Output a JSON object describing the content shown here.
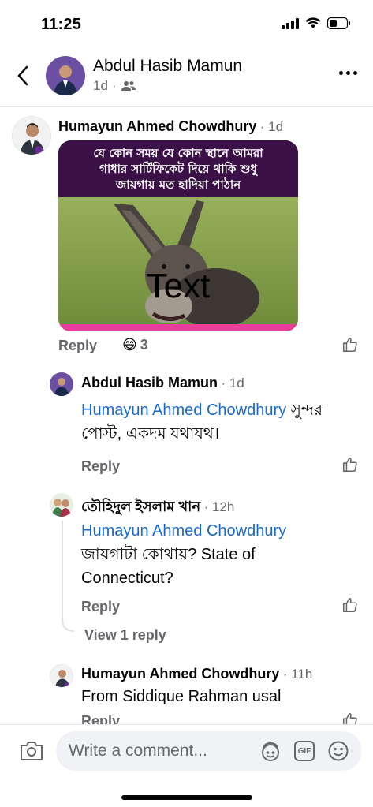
{
  "status": {
    "time": "11:25"
  },
  "header": {
    "name": "Abdul Hasib Mamun",
    "age": "1d",
    "dot": "·"
  },
  "comments": [
    {
      "author": "Humayun Ahmed Chowdhury",
      "time": "· 1d",
      "meme_banner_line1": "যে কোন সময় যে কোন স্থানে আমরা",
      "meme_banner_line2": "গাধার সার্টিফিকেট দিয়ে থাকি শুধু",
      "meme_banner_line3": "জায়গায় মত হাদিয়া পাঠান",
      "meme_overlay": "Text",
      "reply_label": "Reply",
      "reaction_emoji": "😄",
      "reaction_count": "3"
    },
    {
      "author": "Abdul Hasib Mamun",
      "time": "· 1d",
      "mention": "Humayun Ahmed Chowdhury",
      "text_inline": " সুন্দর",
      "text_line2": "পোস্ট, একদম যথাযথ।",
      "reply_label": "Reply"
    },
    {
      "author": "তৌহিদুল ইসলাম খান",
      "time": "· 12h",
      "mention": "Humayun Ahmed Chowdhury",
      "text_line1": "জায়গাটা কোথায়? State of",
      "text_line2": "Connecticut?",
      "reply_label": "Reply",
      "view_replies": "View 1 reply"
    },
    {
      "author": "Humayun Ahmed Chowdhury",
      "time": "· 11h",
      "text_line1": "From Siddique Rahman usal",
      "reply_label": "Reply"
    }
  ],
  "composer": {
    "placeholder": "Write a comment...",
    "gif_label": "GIF"
  },
  "icons": {
    "back": "chevron-left-icon",
    "privacy": "friends-icon",
    "more": "more-icon",
    "like": "thumbs-up-icon",
    "camera": "camera-icon",
    "avatar_sticker": "avatar-sticker-icon",
    "gif": "gif-icon",
    "emoji": "smiley-icon"
  }
}
